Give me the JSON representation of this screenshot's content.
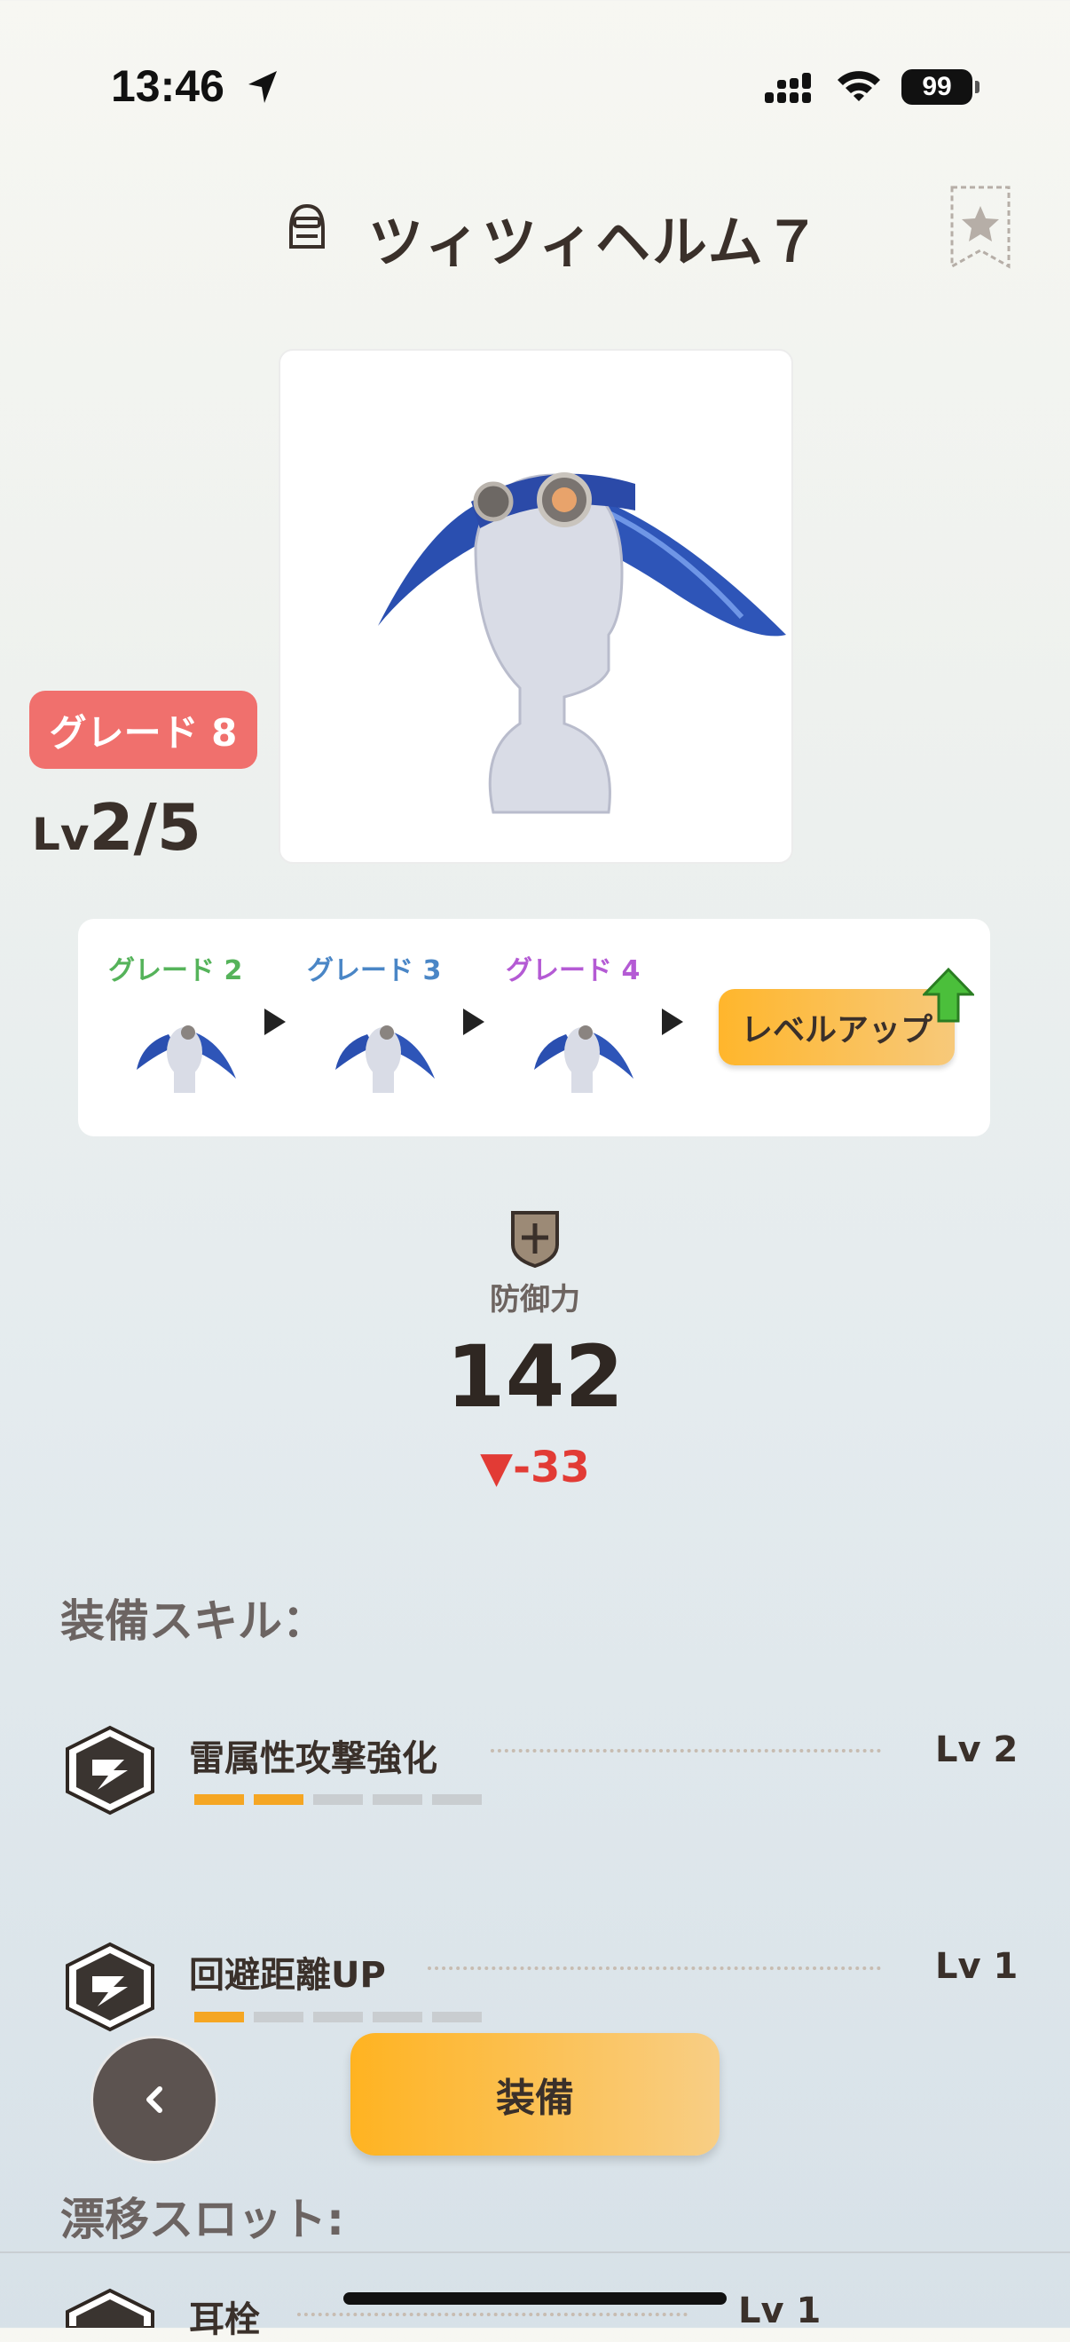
{
  "status": {
    "time": "13:46",
    "battery": "99"
  },
  "header": {
    "title": "ツィツィヘルム７"
  },
  "item": {
    "grade_badge": "グレード 8",
    "level_prefix": "Lv",
    "level_value": "2/5"
  },
  "grades": [
    {
      "label": "グレード 2",
      "color": "#55b35a"
    },
    {
      "label": "グレード 3",
      "color": "#4a86c6"
    },
    {
      "label": "グレード 4",
      "color": "#b45ad4"
    }
  ],
  "level_up_label": "レベルアップ",
  "stat": {
    "label": "防御力",
    "value": "142",
    "diff": "▼-33"
  },
  "skills_section": "装備スキル：",
  "skills": [
    {
      "name": "雷属性攻撃強化",
      "level": "Lv 2",
      "filled": 2,
      "total": 5
    },
    {
      "name": "回避距離UP",
      "level": "Lv 1",
      "filled": 1,
      "total": 5
    }
  ],
  "slot_section": "漂移スロット:",
  "slots": [
    {
      "name": "耳栓",
      "level": "Lv 1"
    }
  ],
  "equip_label": "装備",
  "colors": {
    "accent": "#ffb321",
    "badge": "#f0706d",
    "diff": "#e23b35",
    "bar_on": "#f5a623",
    "bar_off": "#c9cdd0"
  }
}
